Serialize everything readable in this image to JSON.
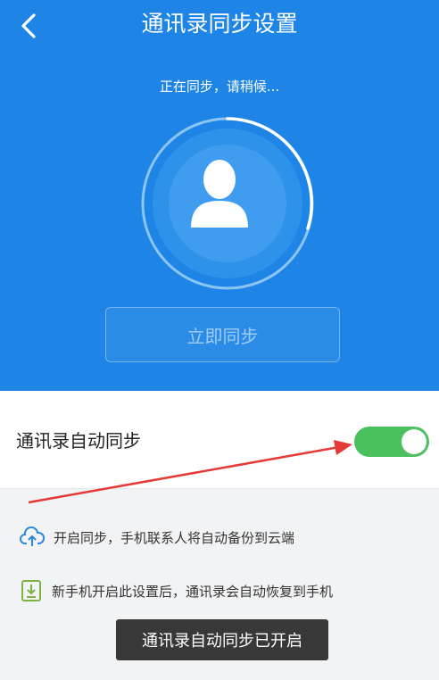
{
  "header": {
    "title": "通讯录同步设置"
  },
  "hero": {
    "status_text": "正在同步，请稍候...",
    "sync_button_label": "立即同步"
  },
  "auto_sync": {
    "label": "通讯录自动同步",
    "enabled": true
  },
  "info": [
    {
      "text": "开启同步，手机联系人将自动备份到云端",
      "icon": "cloud-upload-icon"
    },
    {
      "text": "新手机开启此设置后，通讯录会自动恢复到手机",
      "icon": "download-box-icon"
    }
  ],
  "toast": {
    "text": "通讯录自动同步已开启"
  },
  "colors": {
    "brand_blue": "#1e85e6",
    "toggle_green": "#4cbf5f",
    "arrow_red": "#e53935"
  }
}
